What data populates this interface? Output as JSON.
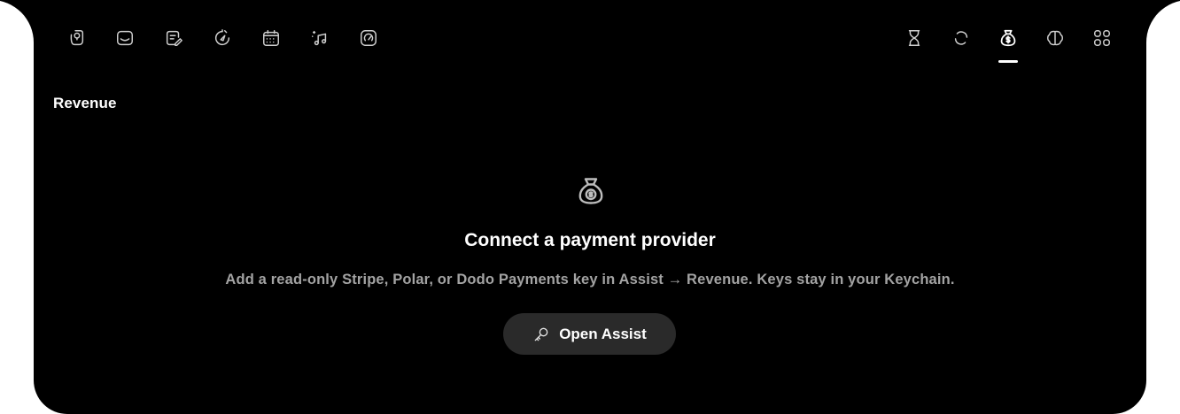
{
  "section": {
    "title": "Revenue"
  },
  "toolbar": {
    "left_icons": [
      "notes-icon",
      "inbox-icon",
      "edit-document-icon",
      "timer-icon",
      "calendar-icon",
      "music-icon",
      "speedometer-icon"
    ],
    "right_icons": [
      "hourglass-icon",
      "sync-icon",
      "money-bag-icon",
      "brain-icon",
      "apps-grid-icon"
    ],
    "active": "money-bag-icon"
  },
  "empty_state": {
    "icon": "money-bag-icon",
    "headline": "Connect a payment provider",
    "description": "Add a read-only Stripe, Polar, or Dodo Payments key in Assist → Revenue. Keys stay in your Keychain.",
    "button_label": "Open Assist",
    "button_icon": "key-icon"
  },
  "colors": {
    "background": "#000000",
    "text": "#ffffff",
    "muted": "#a3a3a3",
    "button": "#2a2a2a"
  }
}
